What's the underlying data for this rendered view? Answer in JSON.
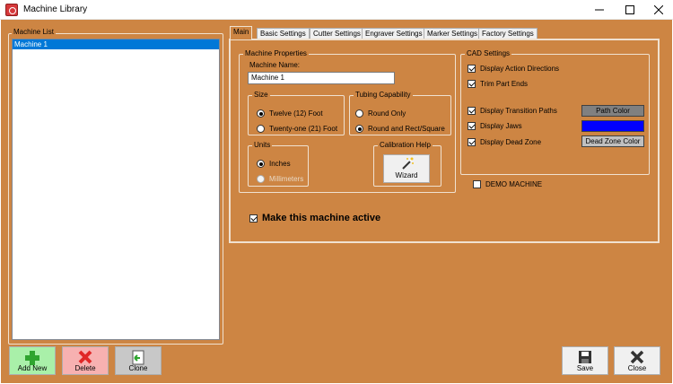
{
  "window": {
    "title": "Machine Library"
  },
  "machine_list": {
    "legend": "Machine List",
    "items": [
      {
        "label": "Machine 1",
        "selected": true
      }
    ]
  },
  "bottom_buttons": {
    "add": "Add New",
    "delete": "Delete",
    "clone": "Clone",
    "save": "Save",
    "close": "Close"
  },
  "tabs": [
    "Main",
    "Basic Settings",
    "Cutter Settings",
    "Engraver Settings",
    "Marker Settings",
    "Factory Settings"
  ],
  "active_tab": "Main",
  "machine_properties": {
    "legend": "Machine Properties",
    "name_label": "Machine Name:",
    "name_value": "Machine 1",
    "size": {
      "legend": "Size",
      "options": [
        "Twelve (12) Foot",
        "Twenty-one (21) Foot"
      ],
      "selected": "Twelve (12) Foot"
    },
    "tubing": {
      "legend": "Tubing Capability",
      "options": [
        "Round Only",
        "Round and Rect/Square"
      ],
      "selected": "Round and Rect/Square"
    },
    "units": {
      "legend": "Units",
      "options": [
        "Inches",
        "Millimeters"
      ],
      "selected": "Inches"
    },
    "calibration": {
      "legend": "Calibration Help",
      "button": "Wizard"
    }
  },
  "cad_settings": {
    "legend": "CAD Settings",
    "display_action_directions": {
      "label": "Display Action Directions",
      "checked": true
    },
    "trim_part_ends": {
      "label": "Trim Part Ends",
      "checked": true
    },
    "display_transition_paths": {
      "label": "Display Transition Paths",
      "checked": true
    },
    "display_jaws": {
      "label": "Display Jaws",
      "checked": true
    },
    "display_dead_zone": {
      "label": "Display Dead Zone",
      "checked": true
    },
    "path_color_button": "Path Color",
    "jaw_color_button": "Jaw Color",
    "dead_zone_color_button": "Dead Zone Color",
    "colors": {
      "path": "#808080",
      "jaw": "#0000ff",
      "dead_zone": "#c0c0c0"
    }
  },
  "demo_machine": {
    "label": "DEMO MACHINE",
    "checked": false
  },
  "make_active": {
    "label": "Make this machine active",
    "checked": true
  },
  "theme": {
    "background": "#cd8543",
    "selection": "#0078d7"
  }
}
